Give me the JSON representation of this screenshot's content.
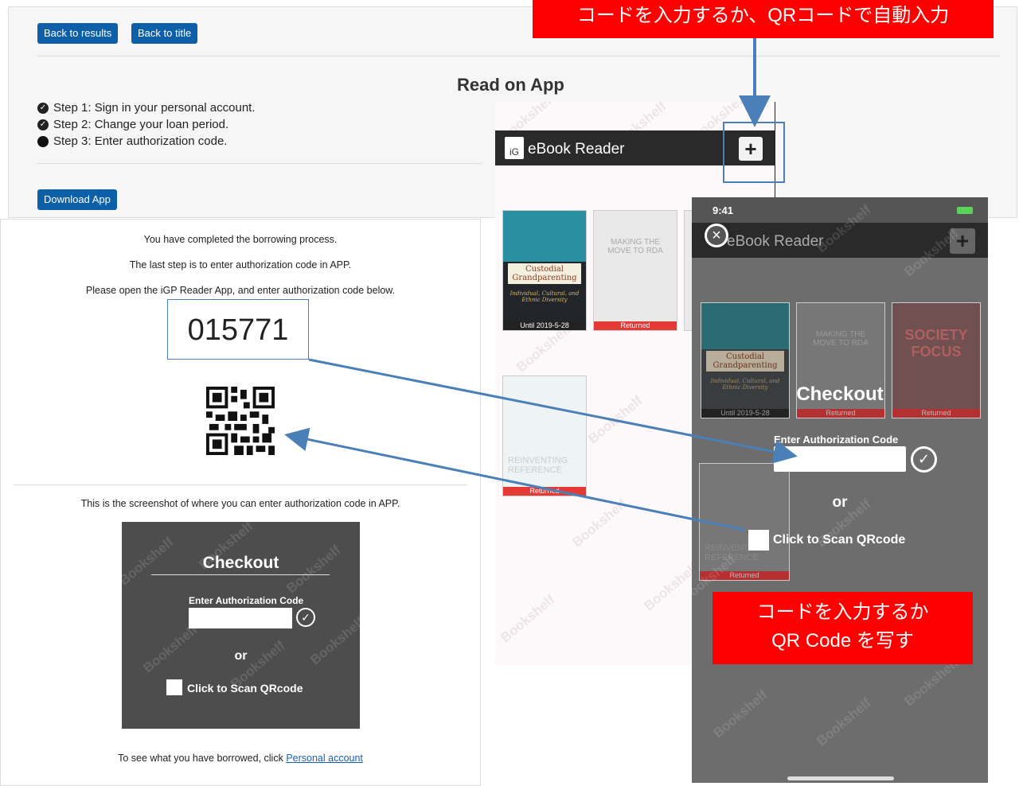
{
  "top": {
    "back_results": "Back to results",
    "back_title": "Back to title",
    "heading": "Read on App",
    "steps": [
      "Step 1: Sign in your personal account.",
      "Step 2: Change your loan period.",
      "Step 3: Enter authorization code."
    ],
    "download": "Download App"
  },
  "left": {
    "line1": "You have completed the borrowing process.",
    "line2": "The last step is to enter authorization code in APP.",
    "line3": "Please open the iGP Reader App, and enter authorization code below.",
    "code": "015771",
    "screenshot_caption": "This is the screenshot of where you can enter authorization code in APP.",
    "borrowed_prefix": "To see what you have borrowed, click",
    "personal_account": "Personal account"
  },
  "checkout": {
    "title": "Checkout",
    "field_label": "Enter Authorization Code",
    "or": "or",
    "scan": "Click to Scan QRcode"
  },
  "app": {
    "logo": "iG",
    "title": "eBook Reader",
    "title2": "eBook Reader",
    "time": "9:41",
    "watermark": "Bookshelf",
    "book1_title": "Custodial Grandparenting",
    "book1_sub": "Individual, Cultural, and Ethnic Diversity",
    "book1_status": "Until 2019-5-28",
    "book2_title": "MAKING THE MOVE TO RDA",
    "book2_status": "Returned",
    "book3_title": "REINVENTING REFERENCE",
    "book3_status": "Returned",
    "book4_title": "SOCIETY FOCUS",
    "book4_status": "Returned"
  },
  "annotations": {
    "top_jp": "コードを入力するか、QRコードで自動入力",
    "bottom_jp_line1": "コードを入力するか",
    "bottom_jp_line2": "QR Code を写す"
  },
  "colors": {
    "button": "#0d5fa8",
    "annotation_red": "#ff0000",
    "arrow_blue": "#4a7fb8",
    "app_header": "#2a2a2a",
    "returned_red": "#e53935"
  }
}
